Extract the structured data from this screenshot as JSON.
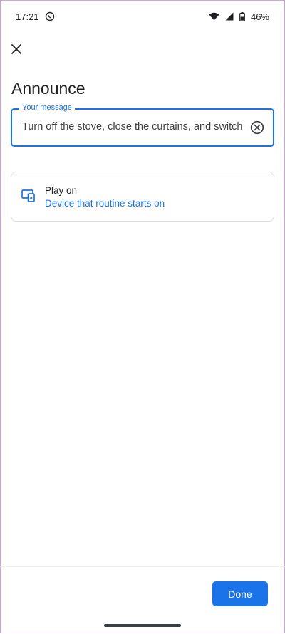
{
  "status_bar": {
    "time": "17:21",
    "battery": "46%",
    "icons": [
      "whatsapp-icon",
      "wifi-icon",
      "signal-icon",
      "battery-icon"
    ]
  },
  "header": {
    "close_icon": "close-icon",
    "title": "Announce"
  },
  "message_field": {
    "label": "Your message",
    "value": "Turn off the stove, close the curtains, and switch o",
    "clear_icon": "clear-circle-icon"
  },
  "play_on": {
    "icon": "speaker-device-icon",
    "title": "Play on",
    "subtitle": "Device that routine starts on"
  },
  "footer": {
    "done_label": "Done"
  },
  "colors": {
    "accent": "#1a73e8",
    "text": "#202124",
    "border": "#dadce0"
  }
}
